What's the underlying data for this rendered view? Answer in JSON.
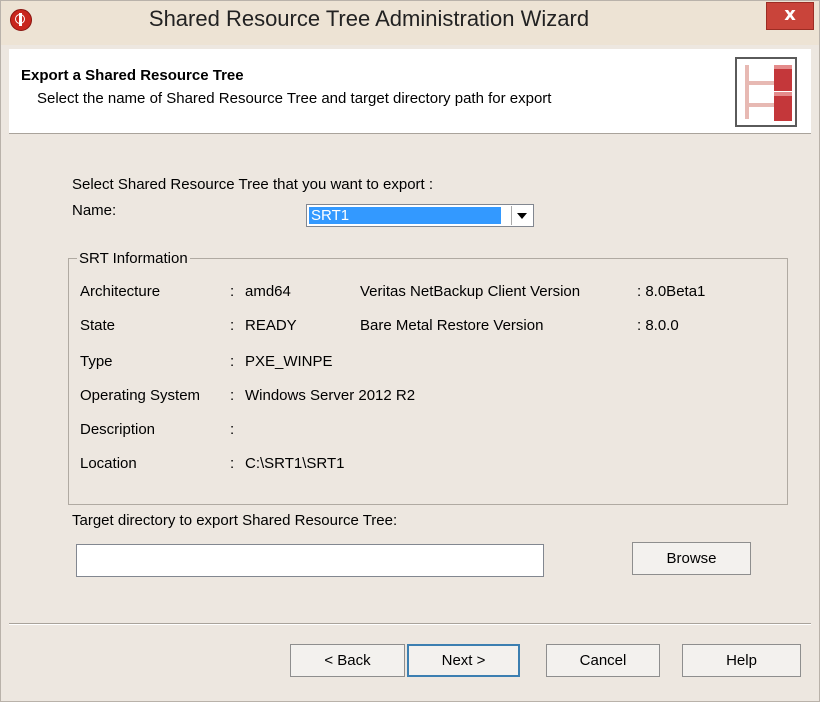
{
  "window": {
    "title": "Shared Resource Tree Administration Wizard",
    "close_label": "x"
  },
  "header": {
    "title": "Export a Shared Resource Tree",
    "subtitle": "Select the name of Shared Resource Tree and target directory path for export"
  },
  "selection": {
    "prompt": "Select Shared Resource Tree that you want to export :",
    "name_label": "Name:",
    "name_value": "SRT1"
  },
  "srt_info": {
    "legend": "SRT Information",
    "rows": [
      {
        "label": "Architecture",
        "sep": ":",
        "value": "amd64"
      },
      {
        "label": "State",
        "sep": ":",
        "value": "READY"
      },
      {
        "label": "Type",
        "sep": ":",
        "value": "PXE_WINPE"
      },
      {
        "label": "Operating System",
        "sep": ":",
        "value": "Windows Server 2012 R2"
      },
      {
        "label": "Description",
        "sep": ":",
        "value": ""
      },
      {
        "label": "Location",
        "sep": ":",
        "value": "C:\\SRT1\\SRT1"
      }
    ],
    "right_rows": [
      {
        "label": "Veritas NetBackup Client Version",
        "value": ": 8.0Beta1"
      },
      {
        "label": "Bare Metal Restore Version",
        "value": ": 8.0.0"
      }
    ]
  },
  "target": {
    "label": "Target directory to export Shared Resource Tree:",
    "value": "",
    "browse_label": "Browse"
  },
  "footer": {
    "back_label": "< Back",
    "next_label": "Next >",
    "cancel_label": "Cancel",
    "help_label": "Help"
  },
  "colors": {
    "accent": "#3399ff",
    "brand_red": "#c8261d",
    "logo_red": "#c4373a"
  },
  "icons": {
    "app": "veritas-app-icon",
    "header_logo": "srt-tree-logo-icon",
    "dropdown": "chevron-down-icon"
  }
}
